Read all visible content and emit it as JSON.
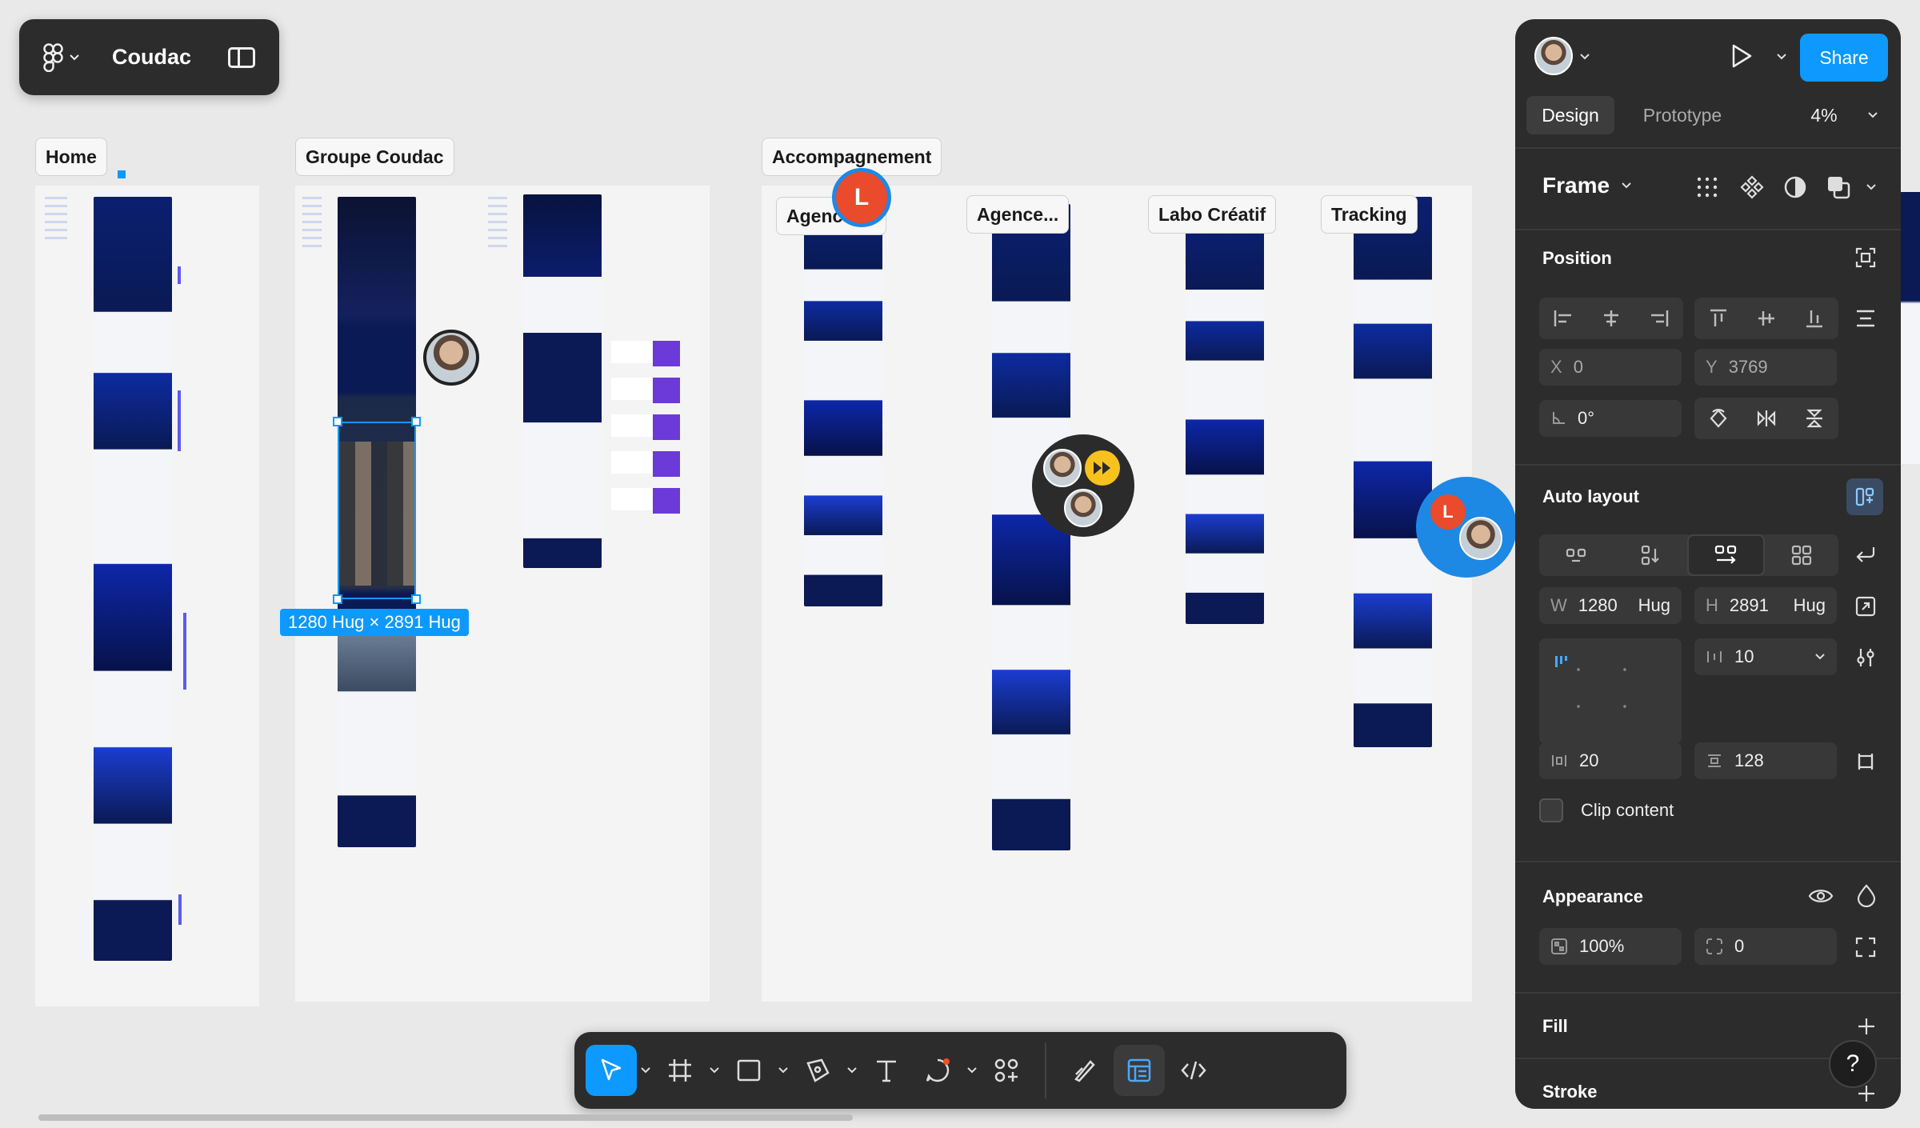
{
  "app": {
    "file_name": "Coudac"
  },
  "canvas": {
    "sections": [
      {
        "label": "Home"
      },
      {
        "label": "Groupe Coudac"
      },
      {
        "label": "Accompagnement"
      }
    ],
    "frame_labels": [
      {
        "label": "Agence IA"
      },
      {
        "label": "Agence..."
      },
      {
        "label": "Labo Créatif"
      },
      {
        "label": "Tracking"
      }
    ],
    "selection_size": "1280 Hug × 2891 Hug",
    "collaborator_initial": "L"
  },
  "panel": {
    "share_label": "Share",
    "tabs": [
      {
        "label": "Design"
      },
      {
        "label": "Prototype"
      }
    ],
    "zoom": "4%",
    "frame_type": "Frame",
    "position": {
      "title": "Position",
      "x_label": "X",
      "x": "0",
      "y_label": "Y",
      "y": "3769",
      "rotation": "0°"
    },
    "auto_layout": {
      "title": "Auto layout",
      "w_label": "W",
      "w": "1280",
      "w_mode": "Hug",
      "h_label": "H",
      "h": "2891",
      "h_mode": "Hug",
      "gap": "10",
      "padding_h": "20",
      "padding_v": "128",
      "clip_label": "Clip content"
    },
    "appearance": {
      "title": "Appearance",
      "opacity": "100%",
      "radius": "0"
    },
    "fill_title": "Fill",
    "stroke_title": "Stroke",
    "help": "?"
  },
  "colors": {
    "accent": "#0d99ff",
    "panel_bg": "#2c2c2c",
    "canvas_bg": "#e9e9e9",
    "brand_navy": "#0b1a55",
    "collaborator": "#e94b2c"
  }
}
